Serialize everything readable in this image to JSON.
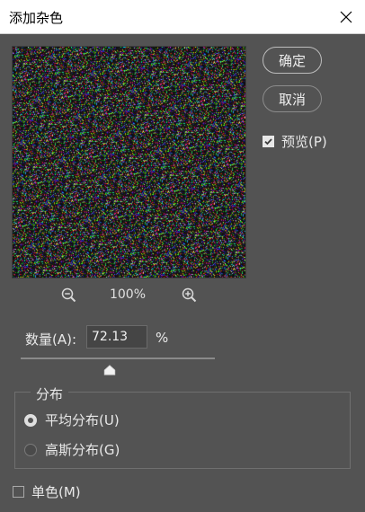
{
  "window": {
    "title": "添加杂色"
  },
  "buttons": {
    "ok_label": "确定",
    "cancel_label": "取消"
  },
  "preview": {
    "label": "预览(P)",
    "checked": true
  },
  "zoom": {
    "level": "100%"
  },
  "amount": {
    "label": "数量(A):",
    "value": "72.13",
    "unit": "%",
    "slider_fraction": 0.46
  },
  "distribution": {
    "title": "分布",
    "options": [
      {
        "label": "平均分布(U)",
        "selected": true
      },
      {
        "label": "高斯分布(G)",
        "selected": false
      }
    ]
  },
  "monochromatic": {
    "label": "单色(M)",
    "checked": false
  },
  "icons": {
    "close": "close-icon",
    "zoom_out": "zoom-out-icon",
    "zoom_in": "zoom-in-icon",
    "check": "check-icon",
    "slider_thumb": "slider-thumb-icon"
  },
  "colors": {
    "dialog_background": "#535353",
    "titlebar_background": "#ffffff",
    "preview_background": "#101010"
  }
}
